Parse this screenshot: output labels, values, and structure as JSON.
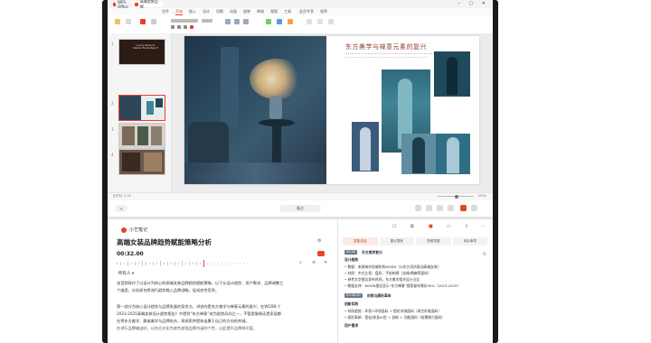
{
  "window": {
    "tabs": [
      {
        "label": "WPS Office"
      },
      {
        "label": "高端女装品牌"
      }
    ],
    "controls": "– ▢ ✕"
  },
  "menubar": {
    "items": [
      "文件",
      "开始",
      "插入",
      "设计",
      "切换",
      "动画",
      "放映",
      "审阅",
      "视图",
      "工具",
      "会员专享",
      "效率"
    ],
    "active_index": 1
  },
  "slide_panel": {
    "slides": [
      {
        "num": "1",
        "title": "Luxury Women's Fashion Trends Report"
      },
      {
        "num": "2",
        "title": ""
      },
      {
        "num": "3",
        "title": ""
      },
      {
        "num": "4",
        "title": ""
      }
    ],
    "selected_index": 1
  },
  "slide": {
    "title": "东方美学与禅意元素的复兴"
  },
  "status": {
    "left": "幻灯片 2 / 8",
    "zoom": "100%"
  },
  "midstrip": {
    "center_label": "备注",
    "left_label": "+"
  },
  "note": {
    "app_name": "小艺笔记",
    "title": "高端女装品牌趋势赋能策略分析",
    "time": "00:32.00",
    "speaker": "所有人",
    "lines": [
      "该音频探讨了以设计为核心的高端女装品牌趋势赋能策略，以下从设计趋势、用户需求、品牌调整三",
      "个维度，分析如何将流行趋势融入品牌战略，促成良性竞争。",
      "",
      "第一部分为核心设计趋势与品牌发展的契合点，讲述的是东方美学与禅意元素的复兴，在WGSN《",
      "2023-2025高端女装设计趋势报告》中提到“东方禅意”成为趋势风向之一，不管是服装还是家居都",
      "在将东方美学、静谧美学与品牌结合，再探索并提炼出属于自己的方向的关键。",
      "在进行品牌输出时，以东方文化为底色加强品牌内涵的个性，以此提升品牌辨识度。"
    ]
  },
  "doc": {
    "tabs": [
      "智能总结",
      "要点提炼",
      "思维导图",
      "待办事项"
    ],
    "selected_tab": 0,
    "section1_chip": "00:00",
    "section1_title": "东方美学复兴",
    "section1_heading": "设计趋势",
    "section1_lines": [
      "• 数据：来源海外权威机构WGSN（以东方风尚驱动高端女装）",
      "• 材质：中式立领、盘扣、手绘刺绣（丝绸/棉麻等面料）",
      "• 参考文字报告发布时间，东方美学相关设计占比",
      "• 数据支持：WGSN报告显示“东方禅意”搜索量年增长50%（2023-2025）"
    ],
    "section2_chip": "00:08:00",
    "section2_title": "材质与廓形革命",
    "section2_heading": "创新实践",
    "section2_lines": [
      "• 材质趋势：环保+环保面料 + 提花羊绒面料（再生纤维面料）",
      "• 廓形革新：宽松/修身/H型 + 创新 + 功能面料（轻薄弹力面料）"
    ],
    "section3_heading": "用户需求"
  }
}
